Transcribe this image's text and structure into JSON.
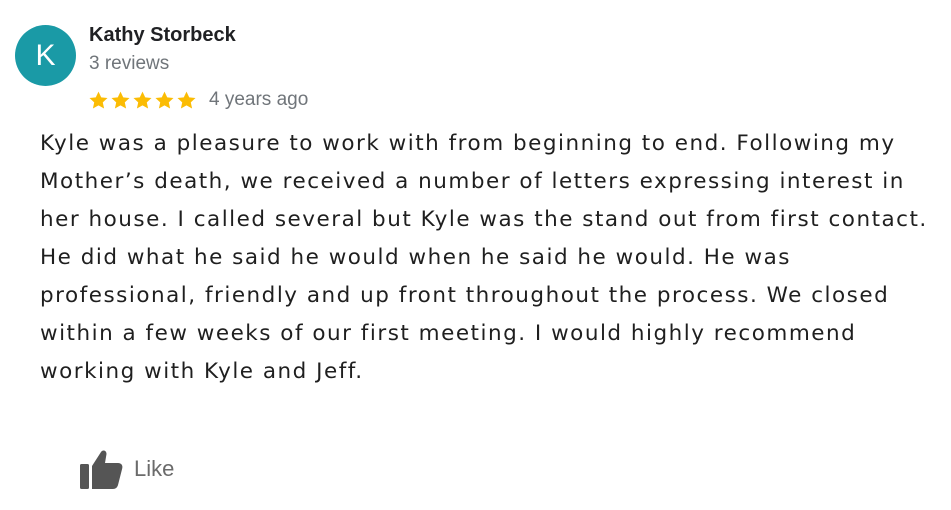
{
  "reviewer": {
    "initial": "K",
    "name": "Kathy Storbeck",
    "reviews_count": "3 reviews",
    "avatar_color": "#1a9aa6"
  },
  "rating": {
    "stars": 5,
    "max_stars": 5,
    "star_color": "#fbbc04",
    "age": "4 years ago"
  },
  "review": {
    "paragraphs": [
      "Kyle was a pleasure to work with from beginning to end. Following my Mother’s death, we received a number of letters expressing interest in her house. I called several but Kyle was the stand out from first contact.",
      "He did what he said he would when he said he would. He was professional, friendly and up front throughout the process. We closed within a few weeks of our first meeting. I would highly recommend working with Kyle and Jeff."
    ]
  },
  "actions": {
    "like_label": "Like",
    "like_icon": "thumbs-up-icon"
  }
}
